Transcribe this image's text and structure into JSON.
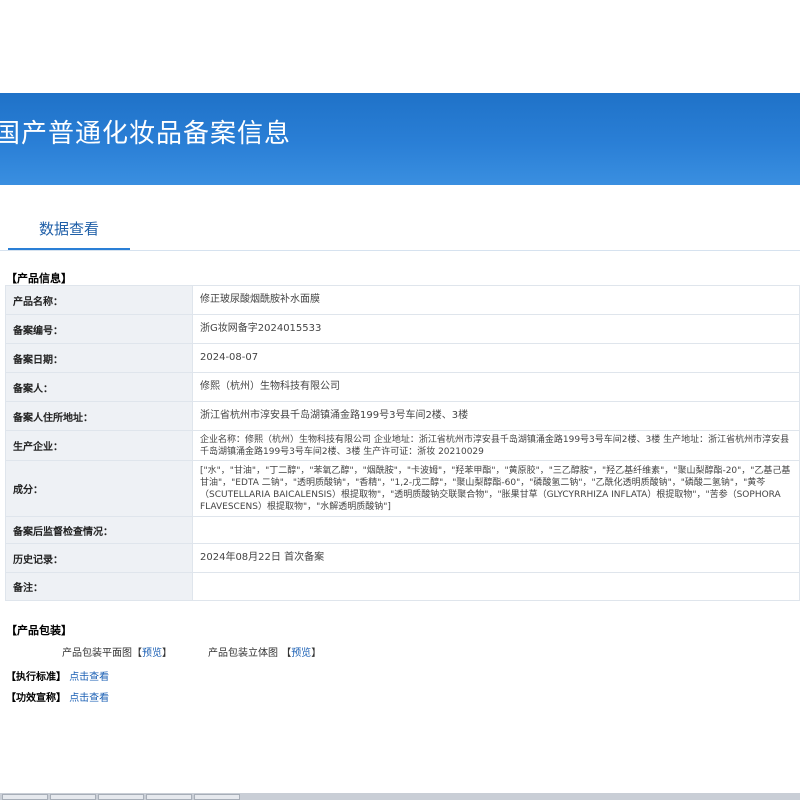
{
  "banner": {
    "title": "国产普通化妆品备案信息"
  },
  "tabs": [
    {
      "label": "数据查看"
    }
  ],
  "product_info": {
    "section_title": "【产品信息】",
    "rows": [
      {
        "label": "产品名称：",
        "value": "修正玻尿酸烟酰胺补水面膜"
      },
      {
        "label": "备案编号：",
        "value": "浙G妆网备字2024015533"
      },
      {
        "label": "备案日期：",
        "value": "2024-08-07"
      },
      {
        "label": "备案人：",
        "value": "修熙（杭州）生物科技有限公司"
      },
      {
        "label": "备案人住所地址：",
        "value": "浙江省杭州市淳安县千岛湖镇涌金路199号3号车间2楼、3楼"
      },
      {
        "label": "生产企业：",
        "value": "企业名称：修熙（杭州）生物科技有限公司 企业地址：浙江省杭州市淳安县千岛湖镇涌金路199号3号车间2楼、3楼 生产地址：浙江省杭州市淳安县千岛湖镇涌金路199号3号车间2楼、3楼 生产许可证：浙妆 20210029"
      },
      {
        "label": "成分：",
        "value": "[\"水\"，\"甘油\"，\"丁二醇\"，\"苯氧乙醇\"，\"烟酰胺\"，\"卡波姆\"，\"羟苯甲酯\"，\"黄原胶\"，\"三乙醇胺\"，\"羟乙基纤维素\"，\"聚山梨醇酯-20\"，\"乙基己基甘油\"，\"EDTA 二钠\"，\"透明质酸钠\"，\"香精\"，\"1,2-戊二醇\"，\"聚山梨醇酯-60\"，\"磷酸氢二钠\"，\"乙酰化透明质酸钠\"，\"磷酸二氢钠\"，\"黄芩（SCUTELLARIA BAICALENSIS）根提取物\"，\"透明质酸钠交联聚合物\"，\"胀果甘草（GLYCYRRHIZA INFLATA）根提取物\"，\"苦参（SOPHORA FLAVESCENS）根提取物\"，\"水解透明质酸钠\"]"
      },
      {
        "label": "备案后监督检查情况：",
        "value": ""
      },
      {
        "label": "历史记录：",
        "value": "2024年08月22日 首次备案"
      },
      {
        "label": "备注：",
        "value": ""
      }
    ]
  },
  "packaging": {
    "section_title": "【产品包装】",
    "flat_label": "产品包装平面图",
    "stereo_label": "产品包装立体图",
    "bracket_open": "【",
    "bracket_close": "】",
    "preview": "预览"
  },
  "standard": {
    "label": "【执行标准】",
    "link": "点击查看"
  },
  "efficacy": {
    "label": "【功效宣称】",
    "link": "点击查看"
  }
}
